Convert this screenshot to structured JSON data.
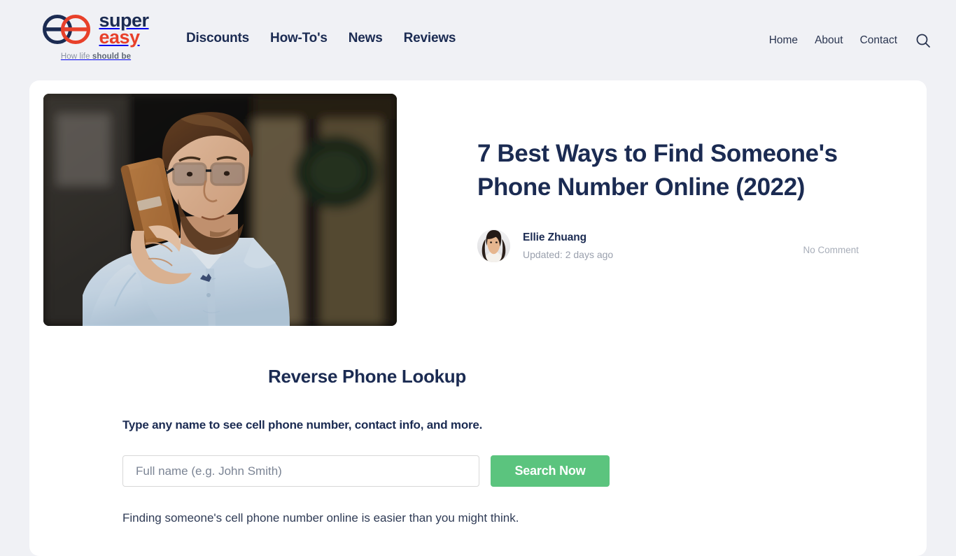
{
  "brand": {
    "logo_icon": "interlocking-circles-logo",
    "name_line1": "super",
    "name_line2": "easy",
    "tagline_regular": "How life ",
    "tagline_bold": "should be",
    "colors": {
      "navy": "#1b2b52",
      "red": "#e8402a",
      "green": "#5bc47e",
      "page_bg": "#f0f1f5"
    }
  },
  "nav": {
    "primary": [
      {
        "label": "Discounts"
      },
      {
        "label": "How-To's"
      },
      {
        "label": "News"
      },
      {
        "label": "Reviews"
      }
    ],
    "utility": [
      {
        "label": "Home"
      },
      {
        "label": "About"
      },
      {
        "label": "Contact"
      }
    ],
    "search_icon": "search-icon"
  },
  "article": {
    "title": "7 Best Ways to Find Someone's Phone Number Online (2022)",
    "hero_image_alt": "man-with-glasses-talking-on-phone",
    "author": {
      "name": "Ellie Zhuang",
      "avatar_alt": "author-avatar-photo",
      "updated": "Updated: 2 days ago"
    },
    "comments": "No Comment"
  },
  "lookup": {
    "title": "Reverse Phone Lookup",
    "subtitle": "Type any name to see cell phone number, contact info, and more.",
    "input_placeholder": "Full name (e.g. John Smith)",
    "input_value": "",
    "button_label": "Search Now"
  },
  "body": {
    "paragraph": "Finding someone's cell phone number online is easier than you might think."
  }
}
